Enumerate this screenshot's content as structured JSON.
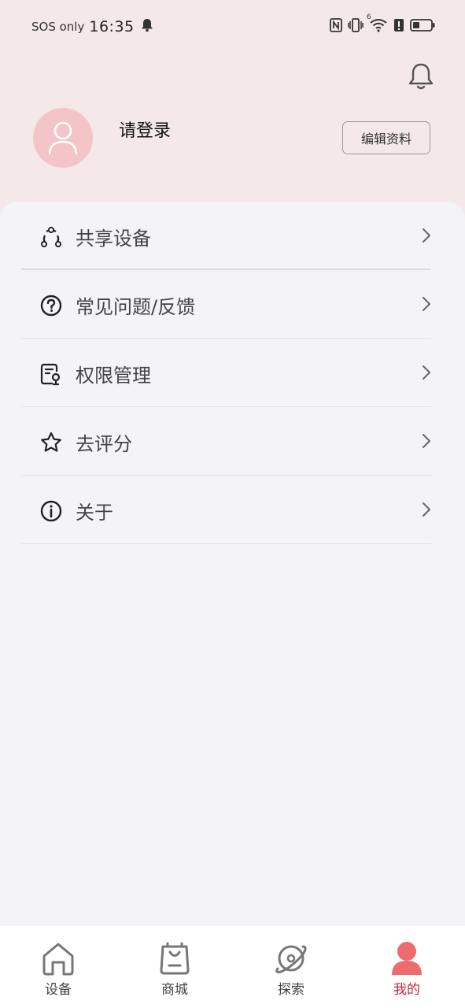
{
  "status_bar": {
    "sos": "SOS only",
    "time": "16:35",
    "icons": [
      "notification-bell-icon",
      "nfc-icon",
      "vibrate-icon",
      "wifi-icon",
      "data-alert-icon",
      "battery-icon"
    ],
    "wifi_superscript": "6"
  },
  "header": {
    "notifications_icon": "bell-icon",
    "avatar_icon": "user-icon",
    "login_prompt": "请登录",
    "edit_profile_label": "编辑资料"
  },
  "menu": {
    "items": [
      {
        "label": "共享设备",
        "icon": "share-icon"
      },
      {
        "label": "常见问题/反馈",
        "icon": "help-icon"
      },
      {
        "label": "权限管理",
        "icon": "permission-icon"
      },
      {
        "label": "去评分",
        "icon": "star-icon"
      },
      {
        "label": "关于",
        "icon": "info-icon"
      }
    ]
  },
  "tab_bar": {
    "tabs": [
      {
        "label": "设备",
        "icon": "home-icon",
        "active": false
      },
      {
        "label": "商城",
        "icon": "shopping-bag-icon",
        "active": false
      },
      {
        "label": "探索",
        "icon": "planet-icon",
        "active": false
      },
      {
        "label": "我的",
        "icon": "profile-icon",
        "active": true
      }
    ]
  },
  "colors": {
    "header_bg": "#f5e8e9",
    "avatar_bg": "#f4c5c8",
    "page_bg": "#f4f3f8",
    "active_tab": "#c8233d",
    "active_icon": "#ee6b6e"
  }
}
